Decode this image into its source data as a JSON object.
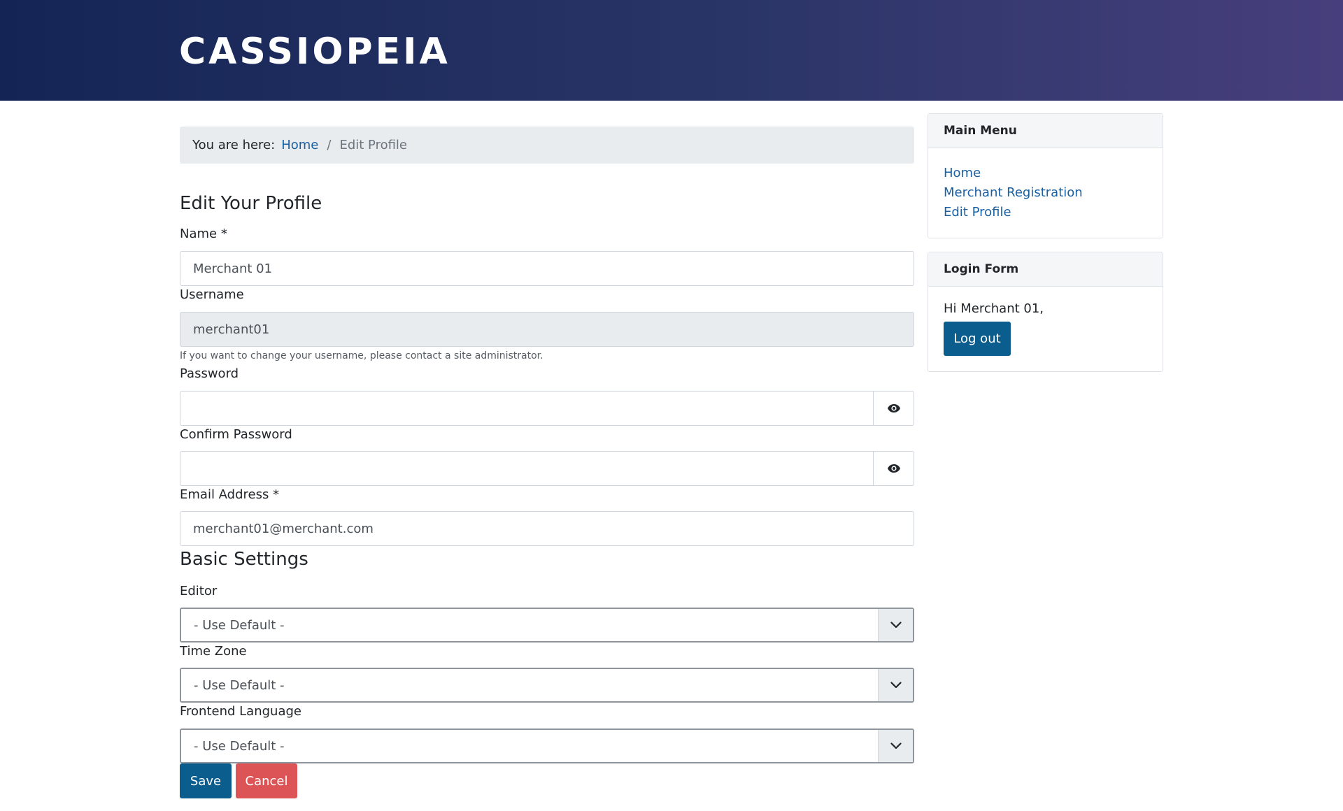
{
  "header": {
    "brand": "CASSIOPEIA"
  },
  "breadcrumb": {
    "prefix": "You are here:",
    "home": "Home",
    "separator": "/",
    "current": "Edit Profile"
  },
  "form": {
    "title": "Edit Your Profile",
    "name": {
      "label": "Name *",
      "value": "Merchant 01"
    },
    "username": {
      "label": "Username",
      "value": "merchant01",
      "help": "If you want to change your username, please contact a site administrator."
    },
    "password": {
      "label": "Password",
      "value": ""
    },
    "confirm_password": {
      "label": "Confirm Password",
      "value": ""
    },
    "email": {
      "label": "Email Address *",
      "value": "merchant01@merchant.com"
    },
    "basic_settings": {
      "title": "Basic Settings",
      "editor": {
        "label": "Editor",
        "value": "- Use Default -"
      },
      "timezone": {
        "label": "Time Zone",
        "value": "- Use Default -"
      },
      "language": {
        "label": "Frontend Language",
        "value": "- Use Default -"
      }
    },
    "save_label": "Save",
    "cancel_label": "Cancel"
  },
  "sidebar": {
    "main_menu": {
      "title": "Main Menu",
      "items": [
        "Home",
        "Merchant Registration",
        "Edit Profile"
      ]
    },
    "login_form": {
      "title": "Login Form",
      "greeting": "Hi Merchant 01,",
      "logout_label": "Log out"
    }
  },
  "colors": {
    "primary": "#0b5d8e",
    "danger": "#dc5455",
    "link": "#1a5fa0",
    "header_start": "#142555",
    "header_end": "#473f7d"
  },
  "icons": {
    "password_toggle": "eye-icon",
    "select_caret": "chevron-down-icon"
  }
}
